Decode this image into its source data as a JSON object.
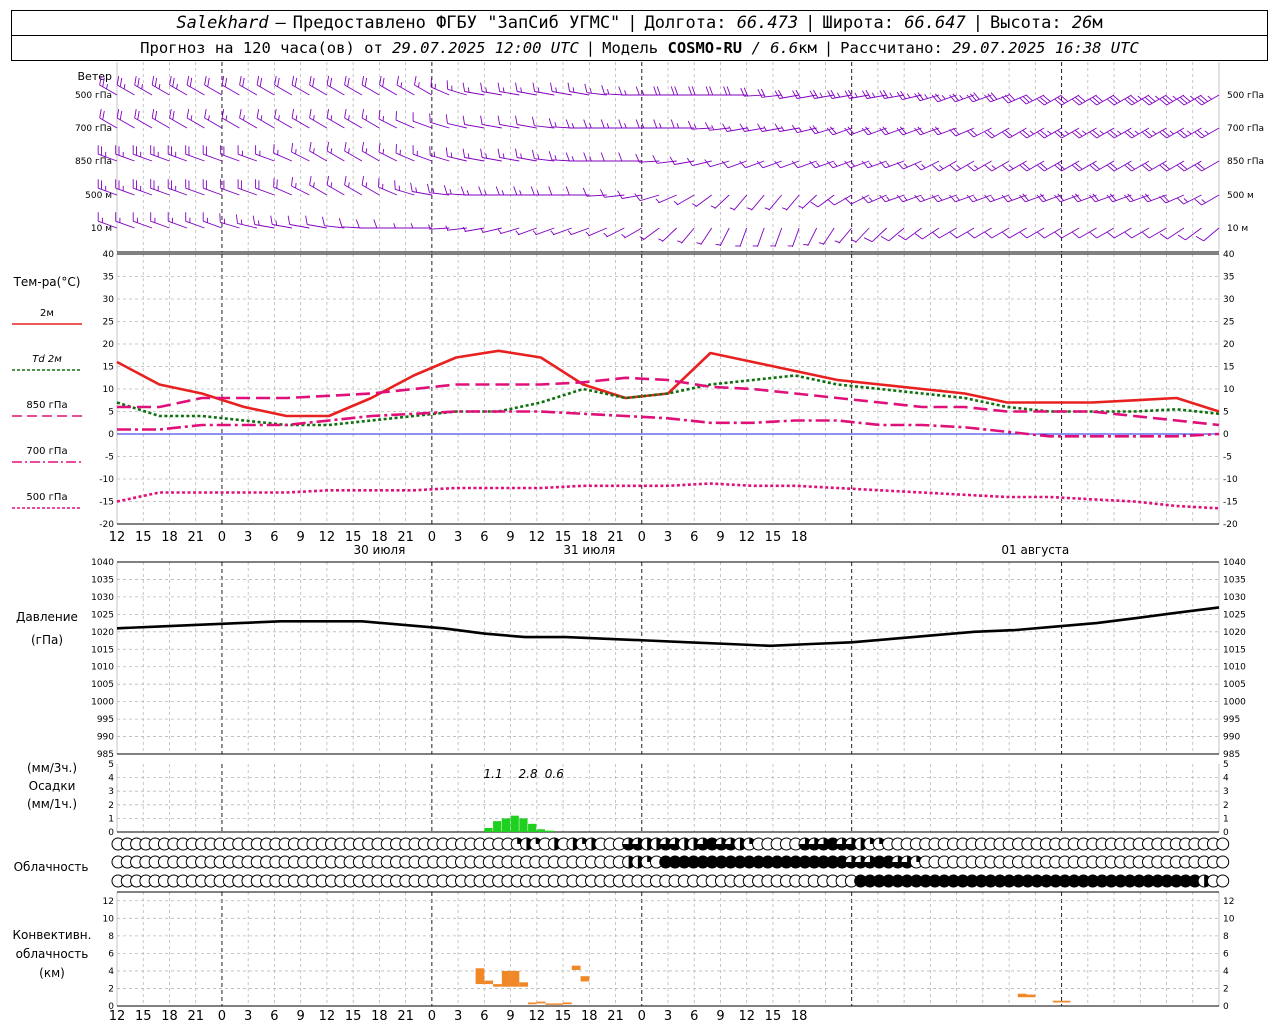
{
  "header": {
    "station": "Salekhard",
    "dash": "–",
    "provided": "Предоставлено ФГБУ \"ЗапСиб УГМС\"",
    "lon_label": "Долгота:",
    "lon_value": "66.473",
    "lat_label": "Широта:",
    "lat_value": "66.647",
    "alt_label": "Высота:",
    "alt_value": "26",
    "alt_unit": "м",
    "forecast_text": "Прогноз на 120 часа(ов) от",
    "forecast_from": "29.07.2025 12:00 UTC",
    "model_label": "Модель",
    "model_name": "COSMO-RU",
    "model_res": "/ 6.6",
    "model_res_unit": "км",
    "calc_label": "Рассчитано:",
    "calc_time": "29.07.2025 16:38 UTC"
  },
  "chart_data": [
    {
      "type": "wind-barbs",
      "panel_label": "Ветер",
      "levels": [
        "500 гПа",
        "700 гПа",
        "850 гПа",
        "500 м",
        "10 м"
      ],
      "barb_color": "#8000c0",
      "x_hours": [
        0,
        6,
        12,
        18,
        24,
        30,
        36,
        42,
        48,
        54,
        60,
        66,
        72,
        78,
        84,
        90,
        96,
        102,
        108,
        114,
        120,
        126
      ],
      "rows": [
        {
          "level": "500 гПа",
          "dir_deg": [
            300,
            300,
            300,
            300,
            300,
            300,
            300,
            280,
            280,
            280,
            270,
            270,
            270,
            260,
            260,
            260,
            250,
            250,
            240,
            240,
            240,
            240
          ],
          "speed_kt": [
            25,
            25,
            20,
            20,
            20,
            20,
            15,
            15,
            15,
            15,
            15,
            20,
            20,
            20,
            25,
            25,
            25,
            30,
            30,
            30,
            35,
            35
          ]
        },
        {
          "level": "700 гПа",
          "dir_deg": [
            300,
            300,
            300,
            300,
            300,
            300,
            290,
            280,
            280,
            270,
            270,
            270,
            260,
            260,
            250,
            250,
            250,
            240,
            240,
            240,
            240,
            240
          ],
          "speed_kt": [
            20,
            20,
            15,
            15,
            15,
            15,
            10,
            10,
            10,
            15,
            15,
            15,
            15,
            15,
            20,
            20,
            20,
            20,
            25,
            25,
            25,
            25
          ]
        },
        {
          "level": "850 гПа",
          "dir_deg": [
            290,
            290,
            290,
            290,
            300,
            300,
            290,
            280,
            280,
            270,
            270,
            260,
            250,
            250,
            250,
            250,
            240,
            240,
            240,
            240,
            240,
            240
          ],
          "speed_kt": [
            25,
            25,
            20,
            15,
            15,
            15,
            15,
            15,
            15,
            15,
            10,
            10,
            10,
            10,
            15,
            15,
            15,
            15,
            20,
            20,
            20,
            20
          ]
        },
        {
          "level": "500 м",
          "dir_deg": [
            290,
            290,
            290,
            290,
            300,
            300,
            280,
            270,
            270,
            270,
            260,
            240,
            220,
            220,
            240,
            250,
            250,
            250,
            250,
            250,
            250,
            240
          ],
          "speed_kt": [
            25,
            25,
            20,
            20,
            15,
            15,
            15,
            15,
            15,
            10,
            10,
            5,
            5,
            5,
            10,
            15,
            15,
            15,
            20,
            20,
            20,
            15
          ]
        },
        {
          "level": "10 м",
          "dir_deg": [
            290,
            290,
            290,
            280,
            280,
            270,
            270,
            260,
            250,
            250,
            240,
            220,
            200,
            200,
            220,
            230,
            240,
            240,
            240,
            240,
            240,
            230
          ],
          "speed_kt": [
            15,
            15,
            15,
            15,
            10,
            10,
            5,
            5,
            5,
            5,
            5,
            5,
            5,
            5,
            5,
            10,
            10,
            10,
            10,
            10,
            10,
            10
          ]
        }
      ]
    },
    {
      "type": "line",
      "panel_label": "Тем-ра(°С)",
      "ylim": [
        -20,
        40
      ],
      "yticks": [
        40,
        35,
        30,
        25,
        20,
        15,
        10,
        5,
        0,
        -5,
        -10,
        -15,
        -20
      ],
      "x_hours": [
        0,
        6,
        12,
        18,
        24,
        30,
        36,
        42,
        48,
        54,
        60,
        66,
        72,
        78,
        84,
        90,
        96,
        102,
        108,
        114,
        120,
        126
      ],
      "series": [
        {
          "name": "2м",
          "color": "#e82020",
          "style": "solid",
          "values": [
            16,
            11,
            9,
            6,
            4,
            4,
            8,
            13,
            17,
            18.5,
            17,
            11,
            8,
            9,
            18,
            16,
            14,
            12,
            11,
            10,
            9,
            7,
            7,
            7,
            7.5,
            8,
            5
          ]
        },
        {
          "name": "Td 2м",
          "color": "#107010",
          "style": "dotted",
          "values": [
            7,
            4,
            4,
            3,
            2,
            2,
            3,
            4,
            5,
            5,
            7,
            10,
            8,
            9,
            11,
            12,
            13,
            11,
            10,
            9,
            8,
            6,
            5,
            5,
            5,
            5.5,
            4.5
          ]
        },
        {
          "name": "850 гПа",
          "color": "#e0107a",
          "style": "dashed",
          "values": [
            6,
            6,
            8,
            8,
            8,
            8.5,
            9,
            10,
            11,
            11,
            11,
            11.5,
            12.5,
            12,
            10.5,
            10,
            9,
            8,
            7,
            6,
            6,
            5,
            5,
            5,
            4,
            3,
            2
          ]
        },
        {
          "name": "700 гПа",
          "color": "#e0107a",
          "style": "dashdot",
          "values": [
            1,
            1,
            2,
            2,
            2,
            3,
            4,
            4.5,
            5,
            5,
            5,
            4.5,
            4,
            3.5,
            2.5,
            2.5,
            3,
            3,
            2,
            2,
            1.5,
            0.5,
            -0.5,
            -0.5,
            -0.5,
            -0.5,
            0
          ]
        },
        {
          "name": "500 гПа",
          "color": "#e0107a",
          "style": "dotted",
          "values": [
            -15,
            -13,
            -13,
            -13,
            -13,
            -12.5,
            -12.5,
            -12.5,
            -12,
            -12,
            -12,
            -11.5,
            -11.5,
            -11.5,
            -11,
            -11.5,
            -11.5,
            -12,
            -12.5,
            -13,
            -13.5,
            -14,
            -14,
            -14.5,
            -15,
            -16,
            -16.5
          ]
        }
      ],
      "x_axis": {
        "tick_labels": [
          "12",
          "15",
          "18",
          "21",
          "0",
          "3",
          "6",
          "9",
          "12",
          "15",
          "18",
          "21",
          "0",
          "3",
          "6",
          "9",
          "12",
          "15",
          "18",
          "21",
          "0",
          "3",
          "6",
          "9",
          "12",
          "15",
          "18"
        ],
        "day_labels": [
          "30 июля",
          "31 июля",
          "01 августа"
        ]
      }
    },
    {
      "type": "line",
      "panel_label": "Давление",
      "panel_unit": "(гПа)",
      "ylim": [
        985,
        1040
      ],
      "yticks": [
        1040,
        1035,
        1030,
        1025,
        1020,
        1015,
        1010,
        1005,
        1000,
        995,
        990,
        985
      ],
      "series": [
        {
          "name": "Давление",
          "color": "#000000",
          "style": "solid",
          "values": [
            1021,
            1021.5,
            1022,
            1022.5,
            1023,
            1023,
            1023,
            1022,
            1021,
            1019.5,
            1018.5,
            1018.5,
            1018,
            1017.5,
            1017,
            1016.5,
            1016,
            1016.5,
            1017,
            1018,
            1019,
            1020,
            1020.5,
            1021.5,
            1022.5,
            1024,
            1025.5,
            1027
          ]
        }
      ]
    },
    {
      "type": "bar",
      "panel_label": "Осадки",
      "unit_top": "(мм/3ч.)",
      "unit_bottom": "(мм/1ч.)",
      "ylim": [
        0,
        5
      ],
      "yticks": [
        5,
        4,
        3,
        2,
        1,
        0
      ],
      "bar_color": "#20d020",
      "hours": [
        42,
        43,
        44,
        45,
        46,
        47,
        48,
        49
      ],
      "values": [
        0.3,
        0.8,
        1.0,
        1.2,
        1.0,
        0.6,
        0.2,
        0.1
      ],
      "annotations": [
        "1.1",
        "2.8",
        "0.6"
      ]
    },
    {
      "type": "cloud-cover",
      "panel_label": "Облачность",
      "rows": [
        {
          "layer": "upper",
          "values": [
            0,
            0,
            0,
            0,
            0,
            0,
            0,
            0,
            0,
            0,
            0,
            0,
            0,
            0,
            0,
            0,
            0,
            0,
            0,
            0,
            0,
            0,
            0,
            0,
            0,
            0,
            0,
            0,
            0,
            0,
            0,
            0,
            0,
            0,
            0,
            0,
            0,
            0,
            0,
            0,
            0,
            0,
            0,
            1,
            2,
            1,
            0,
            2,
            0,
            2,
            1,
            2,
            0,
            0,
            0,
            3,
            3,
            2,
            2,
            3,
            3,
            2,
            2,
            3,
            4,
            3,
            3,
            2,
            1,
            0,
            0,
            0,
            0,
            0,
            3,
            3,
            3,
            4,
            3,
            3,
            2,
            1,
            1,
            0,
            0,
            0,
            0,
            0,
            0,
            0,
            0,
            0,
            0,
            0,
            0,
            0,
            0,
            0,
            0,
            0,
            0,
            0,
            0,
            0,
            0,
            0,
            0,
            0,
            0,
            0,
            0,
            0,
            0,
            0,
            0,
            0,
            0,
            0,
            0,
            0
          ]
        },
        {
          "layer": "middle",
          "values": [
            0,
            0,
            0,
            0,
            0,
            0,
            0,
            0,
            0,
            0,
            0,
            0,
            0,
            0,
            0,
            0,
            0,
            0,
            0,
            0,
            0,
            0,
            0,
            0,
            0,
            0,
            0,
            0,
            0,
            0,
            0,
            0,
            0,
            0,
            0,
            0,
            0,
            0,
            0,
            0,
            0,
            0,
            0,
            0,
            0,
            0,
            0,
            0,
            0,
            0,
            0,
            0,
            0,
            0,
            0,
            2,
            2,
            1,
            0,
            4,
            4,
            4,
            4,
            4,
            4,
            4,
            4,
            4,
            4,
            4,
            4,
            4,
            4,
            4,
            4,
            4,
            4,
            4,
            4,
            3,
            3,
            3,
            4,
            4,
            3,
            3,
            1,
            0,
            0,
            0,
            0,
            0,
            0,
            0,
            0,
            0,
            0,
            0,
            0,
            0,
            0,
            0,
            0,
            0,
            0,
            0,
            0,
            0,
            0,
            0,
            0,
            0,
            0,
            0,
            0,
            0,
            0,
            0,
            0,
            0
          ]
        },
        {
          "layer": "lower",
          "values": [
            0,
            0,
            0,
            0,
            0,
            0,
            0,
            0,
            0,
            0,
            0,
            0,
            0,
            0,
            0,
            0,
            0,
            0,
            0,
            0,
            0,
            0,
            0,
            0,
            0,
            0,
            0,
            0,
            0,
            0,
            0,
            0,
            0,
            0,
            0,
            0,
            0,
            0,
            0,
            0,
            0,
            0,
            0,
            0,
            0,
            0,
            0,
            0,
            0,
            0,
            0,
            0,
            0,
            0,
            0,
            0,
            0,
            0,
            0,
            0,
            0,
            0,
            0,
            0,
            0,
            0,
            0,
            0,
            0,
            0,
            0,
            0,
            0,
            0,
            0,
            0,
            0,
            0,
            0,
            0,
            4,
            4,
            4,
            4,
            4,
            4,
            4,
            4,
            4,
            4,
            4,
            4,
            4,
            4,
            4,
            4,
            4,
            4,
            4,
            4,
            4,
            4,
            4,
            4,
            4,
            4,
            4,
            4,
            4,
            4,
            4,
            4,
            4,
            4,
            4,
            4,
            4,
            2,
            0,
            0
          ]
        }
      ]
    },
    {
      "type": "bar",
      "panel_label": "Конвективн.",
      "panel_label2": "облачность",
      "panel_unit": "(км)",
      "ylim": [
        0,
        13
      ],
      "yticks": [
        12,
        10,
        8,
        6,
        4,
        2,
        0
      ],
      "bar_color": "#f08828",
      "segments": [
        {
          "hour": 41,
          "base": 2.5,
          "top": 4.3
        },
        {
          "hour": 42,
          "base": 2.5,
          "top": 2.9
        },
        {
          "hour": 43,
          "base": 2.2,
          "top": 2.5
        },
        {
          "hour": 44,
          "base": 2.2,
          "top": 4.0
        },
        {
          "hour": 45,
          "base": 2.2,
          "top": 4.0
        },
        {
          "hour": 46,
          "base": 2.2,
          "top": 2.7
        },
        {
          "hour": 47,
          "base": 0.2,
          "top": 0.4
        },
        {
          "hour": 48,
          "base": 0.3,
          "top": 0.5
        },
        {
          "hour": 49,
          "base": 0.2,
          "top": 0.3
        },
        {
          "hour": 50,
          "base": 0.2,
          "top": 0.3
        },
        {
          "hour": 51,
          "base": 0.2,
          "top": 0.4
        },
        {
          "hour": 52,
          "base": 4.1,
          "top": 4.6
        },
        {
          "hour": 53,
          "base": 2.8,
          "top": 3.4
        },
        {
          "hour": 103,
          "base": 1.0,
          "top": 1.4
        },
        {
          "hour": 104,
          "base": 1.0,
          "top": 1.3
        },
        {
          "hour": 107,
          "base": 0.4,
          "top": 0.6
        },
        {
          "hour": 108,
          "base": 0.4,
          "top": 0.6
        }
      ]
    }
  ]
}
